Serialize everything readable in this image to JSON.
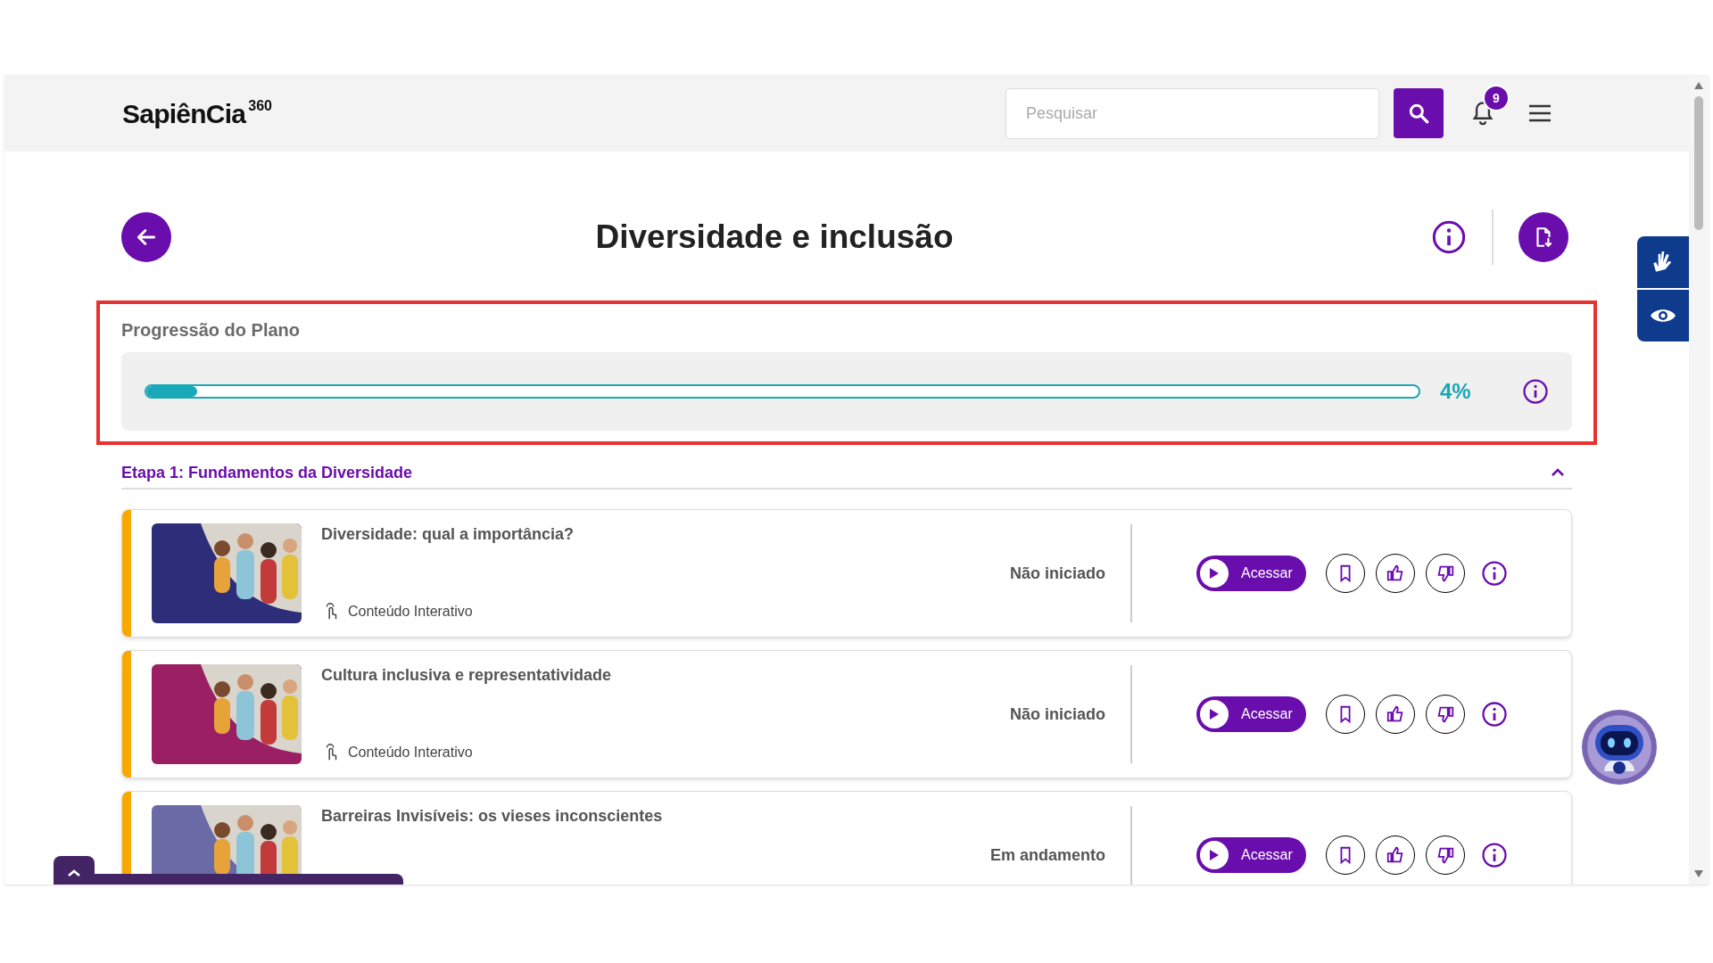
{
  "header": {
    "logo": "SapiênCia",
    "logo_suffix": "360",
    "search": {
      "placeholder": "Pesquisar"
    },
    "notifications": "9"
  },
  "page": {
    "title": "Diversidade e inclusão"
  },
  "progress": {
    "label": "Progressão do Plano",
    "level": 0.04,
    "percent": "4%",
    "highlighted": true
  },
  "stage": {
    "title": "Etapa 1: Fundamentos da Diversidade",
    "expanded": true,
    "items": [
      {
        "title": "Diversidade: qual a importância?",
        "type_label": "Conteúdo Interativo",
        "status": "Não iniciado",
        "action": "Acessar"
      },
      {
        "title": "Cultura inclusiva e representatividade",
        "type_label": "Conteúdo Interativo",
        "status": "Não iniciado",
        "action": "Acessar"
      },
      {
        "title": "Barreiras Invisíveis: os vieses inconscientes",
        "status": "Em andamento",
        "action": "Acessar"
      }
    ]
  }
}
